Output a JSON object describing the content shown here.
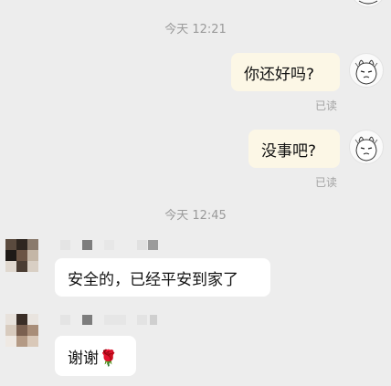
{
  "chat": {
    "timestamps": [
      "今天 12:21",
      "今天 12:45"
    ],
    "messages_out": [
      {
        "text": "你还好吗?",
        "status": "已读"
      },
      {
        "text": "没事吧?",
        "status": "已读"
      }
    ],
    "messages_in": [
      {
        "text": "安全的，已经平安到家了"
      },
      {
        "text": "谢谢🌹"
      }
    ]
  },
  "colors": {
    "background": "#ededed",
    "bubble_out": "#fcf7e6",
    "bubble_in": "#ffffff"
  },
  "icons": [
    "avatar-self-cartoon",
    "avatar-contact-mosaic",
    "name-mosaic",
    "rose-emoji"
  ]
}
